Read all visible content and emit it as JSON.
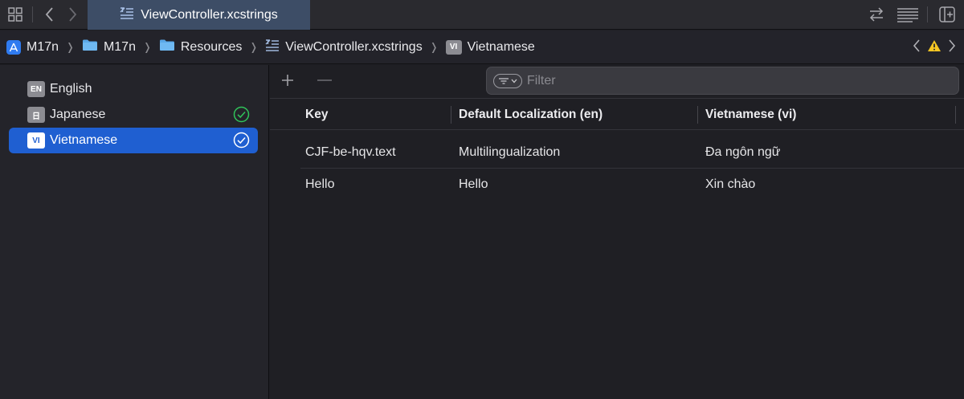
{
  "tab": {
    "title": "ViewController.xcstrings",
    "icon": "strings-file-icon"
  },
  "breadcrumb": [
    {
      "label": "M17n",
      "icon": "app-target-icon"
    },
    {
      "label": "M17n",
      "icon": "folder-icon"
    },
    {
      "label": "Resources",
      "icon": "folder-icon"
    },
    {
      "label": "ViewController.xcstrings",
      "icon": "strings-file-icon"
    },
    {
      "label": "Vietnamese",
      "icon": "language-badge-icon",
      "badge": "VI"
    }
  ],
  "sidebar": {
    "languages": [
      {
        "badge": "EN",
        "name": "English",
        "complete": false,
        "selected": false
      },
      {
        "badge": "日",
        "name": "Japanese",
        "complete": true,
        "selected": false
      },
      {
        "badge": "VI",
        "name": "Vietnamese",
        "complete": true,
        "selected": true
      }
    ]
  },
  "toolbar": {
    "add": "+",
    "remove": "—"
  },
  "filter": {
    "placeholder": "Filter",
    "value": ""
  },
  "table": {
    "columns": [
      "Key",
      "Default Localization (en)",
      "Vietnamese (vi)"
    ],
    "rows": [
      [
        "CJF-be-hqv.text",
        "Multilingualization",
        "Đa ngôn ngữ"
      ],
      [
        "Hello",
        "Hello",
        "Xin chào"
      ]
    ]
  },
  "colors": {
    "selection": "#1f5fd1",
    "tab_active": "#3d4d66",
    "check_green": "#30c45a",
    "warning_yellow": "#f5c623"
  }
}
